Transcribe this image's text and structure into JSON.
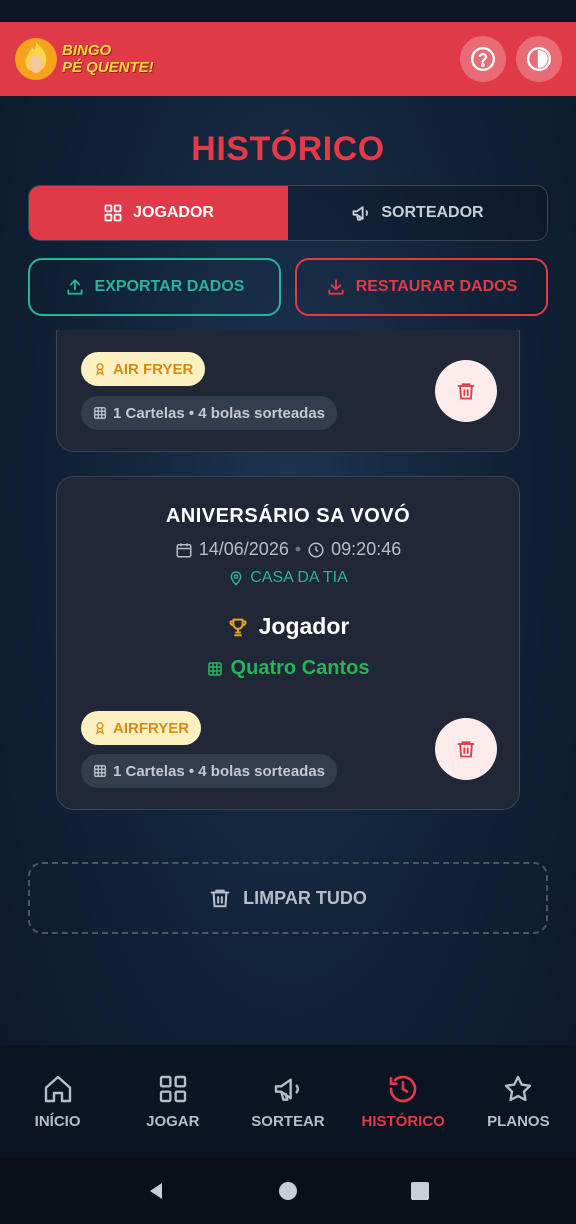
{
  "header": {
    "logo_line1": "BINGO",
    "logo_line2": "PÉ QUENTE!",
    "help_icon": "help-circle-icon",
    "theme_icon": "theme-toggle-icon"
  },
  "page": {
    "title": "HISTÓRICO"
  },
  "tabs": [
    {
      "label": "JOGADOR",
      "icon": "grid-icon",
      "active": true
    },
    {
      "label": "SORTEADOR",
      "icon": "megaphone-icon",
      "active": false
    }
  ],
  "actions": {
    "export_label": "EXPORTAR DADOS",
    "restore_label": "RESTAURAR DADOS"
  },
  "history": [
    {
      "prize": "AIR FRYER",
      "summary": "1 Cartelas • 4 bolas sorteadas"
    },
    {
      "title": "ANIVERSÁRIO SA VOVÓ",
      "date": "14/06/2026",
      "time": "09:20:46",
      "separator": "•",
      "location": "CASA DA TIA",
      "winner": "Jogador",
      "pattern": "Quatro Cantos",
      "prize": "AIRFRYER",
      "summary": "1 Cartelas • 4 bolas sorteadas"
    }
  ],
  "clear_all_label": "LIMPAR TUDO",
  "nav": [
    {
      "label": "INÍCIO",
      "icon": "home-icon",
      "active": false
    },
    {
      "label": "JOGAR",
      "icon": "grid-icon",
      "active": false
    },
    {
      "label": "SORTEAR",
      "icon": "megaphone-icon",
      "active": false
    },
    {
      "label": "HISTÓRICO",
      "icon": "history-icon",
      "active": true
    },
    {
      "label": "PLANOS",
      "icon": "star-icon",
      "active": false
    }
  ],
  "colors": {
    "accent": "#e03a48",
    "teal": "#2ab39a",
    "green": "#27b35a",
    "gold": "#d98a10"
  }
}
